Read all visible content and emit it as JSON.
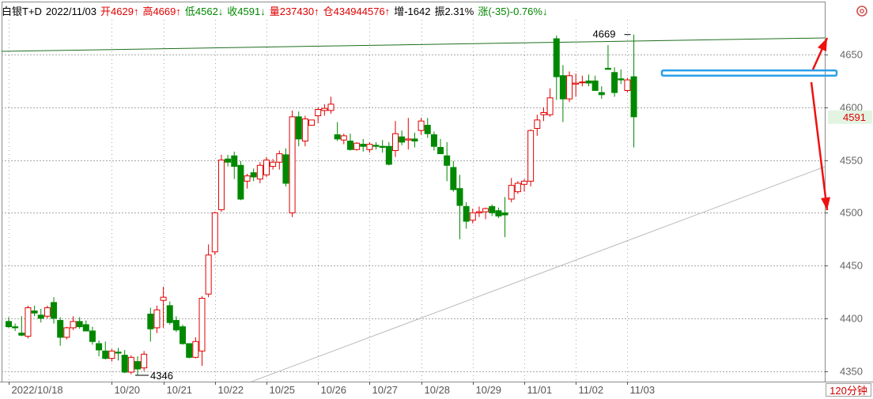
{
  "header": {
    "instrument": "白银T+D",
    "date": "2022/11/03",
    "open": "开4629↑",
    "high": "高4669↑",
    "low": "低4562↓",
    "close": "收4591↓",
    "volume": "量237430↑",
    "open_interest": "仓434944576↑",
    "oi_change": "增-1642",
    "amplitude": "振2.31%",
    "change": "涨(-35)-0.76%↓"
  },
  "period_label": "120分钟",
  "gear_icon": "gear-icon",
  "colors": {
    "up": "#e00000",
    "down": "#008800",
    "grid": "#a8a8a8",
    "box": "#2aa0e8",
    "arrow": "#ee1111"
  },
  "chart_data": {
    "type": "candlestick",
    "ylim": [
      4340,
      4683
    ],
    "yticks": [
      4350,
      4400,
      4450,
      4500,
      4550,
      4600,
      4650
    ],
    "current_price": "4591",
    "date_labels": [
      {
        "text": "2022/10/18",
        "i": 0
      },
      {
        "text": "10/20",
        "i": 16
      },
      {
        "text": "10/21",
        "i": 24
      },
      {
        "text": "10/22",
        "i": 32
      },
      {
        "text": "10/25",
        "i": 40
      },
      {
        "text": "10/26",
        "i": 48
      },
      {
        "text": "10/27",
        "i": 56
      },
      {
        "text": "10/28",
        "i": 64
      },
      {
        "text": "10/29",
        "i": 72
      },
      {
        "text": "11/01",
        "i": 80
      },
      {
        "text": "11/02",
        "i": 88
      },
      {
        "text": "11/03",
        "i": 96
      }
    ],
    "candles": [
      [
        4397,
        4401,
        4391,
        4392
      ],
      [
        4392,
        4395,
        4388,
        4391
      ],
      [
        4386,
        4402,
        4383,
        4384
      ],
      [
        4383,
        4412,
        4381,
        4410
      ],
      [
        4407,
        4412,
        4402,
        4405
      ],
      [
        4403,
        4409,
        4396,
        4400
      ],
      [
        4402,
        4412,
        4400,
        4410
      ],
      [
        4415,
        4420,
        4395,
        4400
      ],
      [
        4398,
        4401,
        4374,
        4382
      ],
      [
        4382,
        4392,
        4380,
        4391
      ],
      [
        4391,
        4402,
        4389,
        4397
      ],
      [
        4397,
        4401,
        4390,
        4392
      ],
      [
        4394,
        4398,
        4388,
        4388
      ],
      [
        4388,
        4392,
        4375,
        4378
      ],
      [
        4376,
        4379,
        4364,
        4370
      ],
      [
        4369,
        4378,
        4361,
        4362
      ],
      [
        4362,
        4371,
        4359,
        4369
      ],
      [
        4368,
        4372,
        4360,
        4367
      ],
      [
        4365,
        4370,
        4348,
        4349
      ],
      [
        4349,
        4365,
        4347,
        4363
      ],
      [
        4359,
        4364,
        4346,
        4352
      ],
      [
        4353,
        4369,
        4350,
        4366
      ],
      [
        4404,
        4410,
        4378,
        4390
      ],
      [
        4391,
        4412,
        4386,
        4408
      ],
      [
        4417,
        4430,
        4391,
        4420
      ],
      [
        4412,
        4416,
        4394,
        4396
      ],
      [
        4398,
        4402,
        4387,
        4389
      ],
      [
        4392,
        4394,
        4375,
        4376
      ],
      [
        4376,
        4376,
        4362,
        4363
      ],
      [
        4363,
        4382,
        4362,
        4378
      ],
      [
        4369,
        4421,
        4355,
        4419
      ],
      [
        4423,
        4470,
        4420,
        4460
      ],
      [
        4463,
        4501,
        4460,
        4500
      ],
      [
        4503,
        4555,
        4501,
        4550
      ],
      [
        4551,
        4555,
        4544,
        4548
      ],
      [
        4554,
        4558,
        4532,
        4544
      ],
      [
        4545,
        4549,
        4512,
        4513
      ],
      [
        4530,
        4537,
        4523,
        4535
      ],
      [
        4538,
        4542,
        4530,
        4534
      ],
      [
        4532,
        4548,
        4528,
        4545
      ],
      [
        4536,
        4553,
        4534,
        4550
      ],
      [
        4544,
        4551,
        4541,
        4548
      ],
      [
        4548,
        4559,
        4541,
        4556
      ],
      [
        4555,
        4561,
        4525,
        4528
      ],
      [
        4500,
        4597,
        4496,
        4591
      ],
      [
        4591,
        4596,
        4563,
        4570
      ],
      [
        4568,
        4592,
        4563,
        4589
      ],
      [
        4583,
        4588,
        4583,
        4588
      ],
      [
        4592,
        4600,
        4585,
        4598
      ],
      [
        4597,
        4603,
        4592,
        4599
      ],
      [
        4597,
        4610,
        4594,
        4603
      ],
      [
        4574,
        4586,
        4568,
        4570
      ],
      [
        4569,
        4575,
        4565,
        4573
      ],
      [
        4568,
        4575,
        4559,
        4560
      ],
      [
        4560,
        4567,
        4559,
        4566
      ],
      [
        4565,
        4570,
        4558,
        4563
      ],
      [
        4560,
        4567,
        4557,
        4565
      ],
      [
        4564,
        4567,
        4560,
        4563
      ],
      [
        4563,
        4569,
        4557,
        4562
      ],
      [
        4563,
        4567,
        4545,
        4546
      ],
      [
        4559,
        4587,
        4553,
        4575
      ],
      [
        4572,
        4578,
        4564,
        4567
      ],
      [
        4569,
        4590,
        4560,
        4570
      ],
      [
        4570,
        4576,
        4562,
        4568
      ],
      [
        4578,
        4590,
        4574,
        4587
      ],
      [
        4583,
        4590,
        4571,
        4575
      ],
      [
        4574,
        4577,
        4559,
        4563
      ],
      [
        4562,
        4570,
        4556,
        4556
      ],
      [
        4554,
        4567,
        4530,
        4545
      ],
      [
        4543,
        4549,
        4520,
        4522
      ],
      [
        4523,
        4536,
        4475,
        4507
      ],
      [
        4506,
        4510,
        4485,
        4492
      ],
      [
        4493,
        4504,
        4490,
        4500
      ],
      [
        4500,
        4506,
        4496,
        4501
      ],
      [
        4501,
        4505,
        4494,
        4504
      ],
      [
        4506,
        4508,
        4497,
        4500
      ],
      [
        4502,
        4505,
        4495,
        4497
      ],
      [
        4500,
        4515,
        4477,
        4498
      ],
      [
        4513,
        4533,
        4510,
        4526
      ],
      [
        4520,
        4530,
        4518,
        4528
      ],
      [
        4527,
        4532,
        4520,
        4530
      ],
      [
        4530,
        4579,
        4525,
        4578
      ],
      [
        4580,
        4593,
        4573,
        4588
      ],
      [
        4593,
        4600,
        4587,
        4595
      ],
      [
        4593,
        4618,
        4591,
        4609
      ],
      [
        4665,
        4668,
        4607,
        4629
      ],
      [
        4630,
        4640,
        4586,
        4608
      ],
      [
        4608,
        4634,
        4605,
        4630
      ],
      [
        4622,
        4632,
        4610,
        4623
      ],
      [
        4624,
        4630,
        4620,
        4624
      ],
      [
        4625,
        4631,
        4620,
        4623
      ],
      [
        4625,
        4630,
        4618,
        4616
      ],
      [
        4614,
        4620,
        4608,
        4612
      ],
      [
        4637,
        4659,
        4636,
        4636
      ],
      [
        4633,
        4638,
        4610,
        4614
      ],
      [
        4627,
        4636,
        4622,
        4626
      ],
      [
        4616,
        4628,
        4614,
        4626
      ],
      [
        4629,
        4669,
        4562,
        4591
      ]
    ],
    "annotations": [
      {
        "text": "4669",
        "i": 97,
        "price": 4669
      },
      {
        "text": "4346",
        "i": 20,
        "price": 4346
      }
    ]
  }
}
